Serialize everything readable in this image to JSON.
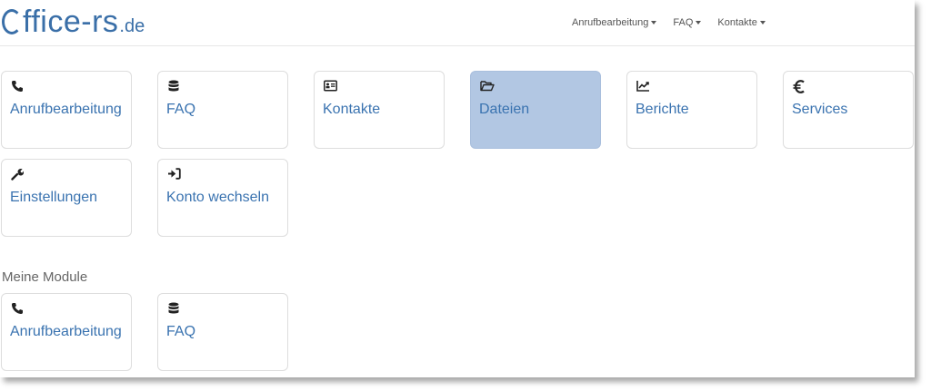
{
  "logo": {
    "main": "ffice-rs",
    "tld": ".de"
  },
  "nav": [
    {
      "label": "Anrufbearbeitung"
    },
    {
      "label": "FAQ"
    },
    {
      "label": "Kontakte"
    }
  ],
  "tiles": [
    {
      "label": "Anrufbearbeitung",
      "icon": "phone-icon"
    },
    {
      "label": "FAQ",
      "icon": "database-icon"
    },
    {
      "label": "Kontakte",
      "icon": "contact-card-icon"
    },
    {
      "label": "Dateien",
      "icon": "folder-open-icon",
      "active": true
    },
    {
      "label": "Berichte",
      "icon": "chart-icon"
    },
    {
      "label": "Services",
      "icon": "euro-icon"
    },
    {
      "label": "Einstellungen",
      "icon": "wrench-icon"
    },
    {
      "label": "Konto wechseln",
      "icon": "sign-in-icon"
    }
  ],
  "modules": {
    "title": "Meine Module",
    "tiles": [
      {
        "label": "Anrufbearbeitung",
        "icon": "phone-icon"
      },
      {
        "label": "FAQ",
        "icon": "database-icon"
      }
    ]
  },
  "colors": {
    "link": "#3a73b0",
    "active_tile": "#b2c7e3",
    "logo": "#3a6fa8"
  }
}
